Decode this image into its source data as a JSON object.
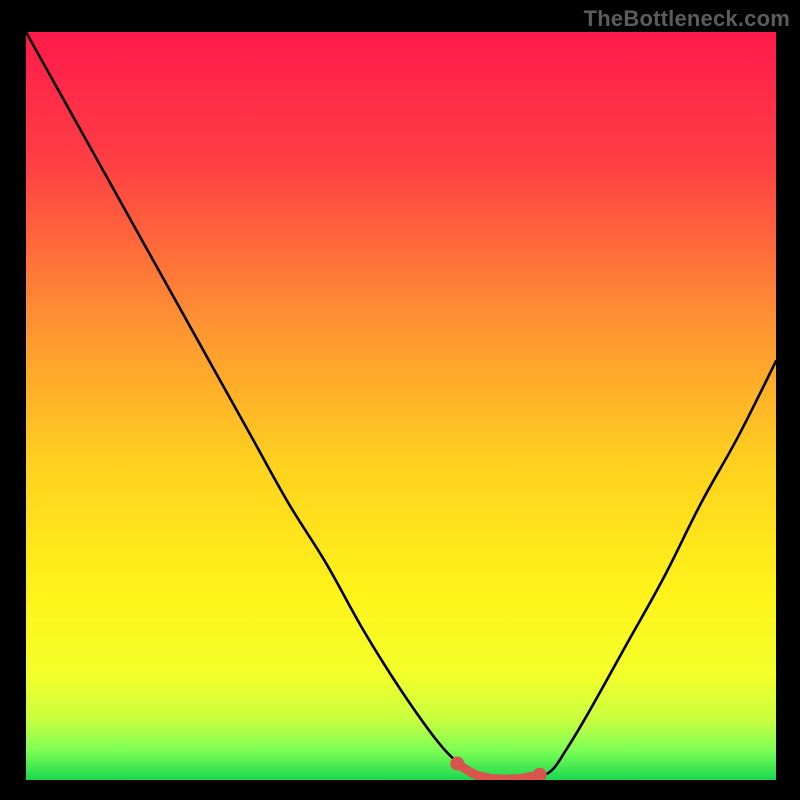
{
  "watermark": "TheBottleneck.com",
  "chart_data": {
    "type": "line",
    "title": "",
    "xlabel": "",
    "ylabel": "",
    "xlim": [
      0,
      100
    ],
    "ylim": [
      0,
      100
    ],
    "background": "gradient-red-yellow-green",
    "series": [
      {
        "name": "curve",
        "color": "#000000",
        "x": [
          0,
          5,
          10,
          15,
          20,
          25,
          30,
          35,
          40,
          45,
          50,
          55,
          58,
          60,
          62,
          64,
          66,
          68,
          70,
          72,
          75,
          80,
          85,
          90,
          95,
          100
        ],
        "values": [
          100,
          91,
          82,
          73,
          64,
          55,
          46,
          37,
          29,
          20,
          12,
          5,
          2,
          0.7,
          0.2,
          0.1,
          0.2,
          0.5,
          1.2,
          4,
          9,
          18,
          27,
          37,
          46,
          56
        ]
      },
      {
        "name": "highlight",
        "color": "#d9544d",
        "x": [
          57.5,
          59,
          60,
          61,
          62,
          63,
          64,
          65,
          66,
          67,
          68.5
        ],
        "values": [
          2.2,
          1.2,
          0.7,
          0.4,
          0.2,
          0.15,
          0.1,
          0.15,
          0.2,
          0.4,
          0.7
        ]
      }
    ],
    "markers": [
      {
        "name": "highlight-start",
        "x": 57.5,
        "y": 2.2,
        "color": "#d9544d"
      },
      {
        "name": "highlight-end",
        "x": 68.5,
        "y": 0.7,
        "color": "#d9544d"
      }
    ]
  },
  "gradient_stops": [
    {
      "offset": 0,
      "color": "#ff1a4b"
    },
    {
      "offset": 18,
      "color": "#ff4044"
    },
    {
      "offset": 38,
      "color": "#ff8f33"
    },
    {
      "offset": 58,
      "color": "#ffd21f"
    },
    {
      "offset": 75,
      "color": "#fff31a"
    },
    {
      "offset": 86,
      "color": "#f3ff2a"
    },
    {
      "offset": 92,
      "color": "#c8ff40"
    },
    {
      "offset": 96,
      "color": "#7dff55"
    },
    {
      "offset": 100,
      "color": "#1bd84e"
    }
  ]
}
